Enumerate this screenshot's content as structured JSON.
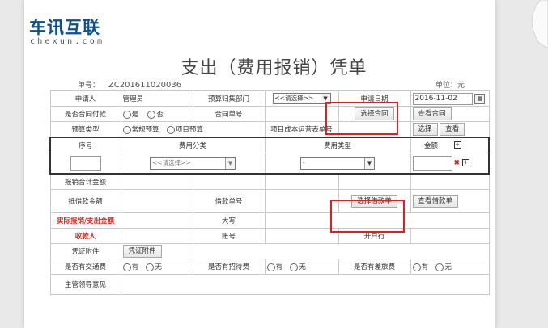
{
  "logo": {
    "cn": "车讯互联",
    "en": "chexun.com"
  },
  "title": "支出（费用报销）凭单",
  "doc_no_label": "单号：",
  "doc_no": "ZC201611020036",
  "unit": "单位：元",
  "rows": {
    "applicant_label": "申请人",
    "applicant_value": "管理员",
    "budget_dept_label": "预算归集部门",
    "budget_dept_select": "<<请选择>>",
    "apply_date_label": "申请日期",
    "apply_date_value": "2016-11-02",
    "contract_pay_label": "是否合同付款",
    "yes": "是",
    "no": "否",
    "contract_no_label": "合同单号",
    "select_contract_btn": "选择合同",
    "view_contract_btn": "查看合同",
    "budget_type_label": "预算类型",
    "budget_regular": "常规预算",
    "budget_project": "项目预算",
    "project_cost_label": "项目成本运营表单号",
    "select_btn": "选择",
    "view_btn": "查看",
    "col_no": "序号",
    "col_fee_category": "费用分类",
    "col_fee_type": "费用类型",
    "col_amount": "金额",
    "fee_category_select": "<<请选择>>",
    "fee_type_select": "-",
    "total_label": "报销合计金额",
    "loan_offset_label": "抵借款金额",
    "loan_no_label": "借款单号",
    "select_loan_btn": "选择借款单",
    "view_loan_btn": "查看借款单",
    "actual_label": "实际报销/支出金额",
    "uppercase_label": "大写",
    "payee_label": "收款人",
    "account_label": "账号",
    "bank_label": "开户行",
    "attachment_label": "凭证附件",
    "attachment_btn": "凭证附件",
    "transport_label": "是否有交通费",
    "entertain_label": "是否有招待费",
    "travel_label": "是否有差旅费",
    "radio_yes": "有",
    "radio_no": "无",
    "leader_label": "主管领导意见"
  }
}
